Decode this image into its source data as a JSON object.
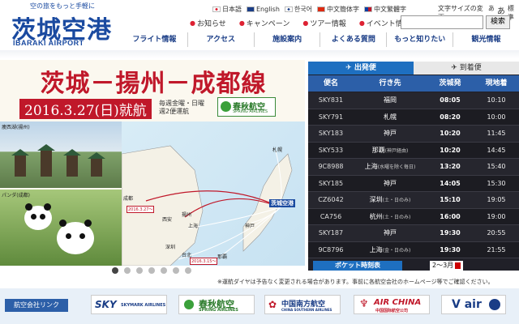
{
  "header": {
    "tagline": "空の旅をもっと手軽に",
    "logo_main": "茨城空港",
    "logo_sub": "IBARAKI AIRPORT",
    "languages": [
      {
        "label": "日本語",
        "flag_color": "#ffffff"
      },
      {
        "label": "English",
        "flag_color": "#1a3d86"
      },
      {
        "label": "한국어",
        "flag_color": "#ffffff"
      },
      {
        "label": "中文簡体字",
        "flag_color": "#de2910"
      },
      {
        "label": "中文繁體字",
        "flag_color": "#0a3ea3"
      }
    ],
    "font_size_label": "文字サイズの変更:",
    "font_sizes": [
      "あ",
      "あ",
      "標準"
    ],
    "sub_links": [
      "お知らせ",
      "キャンペーン",
      "ツアー情報",
      "イベント情報"
    ],
    "search_placeholder": "",
    "search_button": "検索"
  },
  "nav": {
    "items": [
      "フライト情報",
      "アクセス",
      "施設案内",
      "よくある質問",
      "もっと知りたい",
      "観光情報"
    ]
  },
  "banner": {
    "title": "茨城－揚州－成都線",
    "date": "2016.3.27(日)就航",
    "frequency": [
      "毎週金曜・日曜",
      "週2便運航"
    ],
    "spring_cn": "春秋航空",
    "spring_en": "SPRING AIRLINES",
    "photo1_label": "痩西湖(揚州)",
    "photo2_label": "パンダ(成都)",
    "map_cities": [
      "札幌",
      "茨城空港",
      "成都",
      "揚州",
      "上海",
      "神戸",
      "西安",
      "深圳",
      "台北",
      "那覇"
    ],
    "route_date_1": "2016.3.27～",
    "route_date_2": "2016.3.15～"
  },
  "slider": {
    "count": 7,
    "active": 0
  },
  "board": {
    "tab_departure": "出発便",
    "tab_arrival": "到着便",
    "headers": [
      "便名",
      "行き先",
      "茨城発",
      "現地着"
    ],
    "flights": [
      {
        "flight": "SKY831",
        "dest": "福岡",
        "note": "",
        "dep": "08:05",
        "arr": "10:10"
      },
      {
        "flight": "SKY791",
        "dest": "札幌",
        "note": "",
        "dep": "08:20",
        "arr": "10:00"
      },
      {
        "flight": "SKY183",
        "dest": "神戸",
        "note": "",
        "dep": "10:20",
        "arr": "11:45"
      },
      {
        "flight": "SKY533",
        "dest": "那覇",
        "note": "(神戸経由)",
        "dep": "10:20",
        "arr": "14:45"
      },
      {
        "flight": "9C8988",
        "dest": "上海",
        "note": "(水曜を除く毎日)",
        "dep": "13:20",
        "arr": "15:40"
      },
      {
        "flight": "SKY185",
        "dest": "神戸",
        "note": "",
        "dep": "14:05",
        "arr": "15:30"
      },
      {
        "flight": "CZ6042",
        "dest": "深圳",
        "note": "(土・日のみ)",
        "dep": "15:10",
        "arr": "19:05"
      },
      {
        "flight": "CA756",
        "dest": "杭州",
        "note": "(土・日のみ)",
        "dep": "16:00",
        "arr": "19:00"
      },
      {
        "flight": "SKY187",
        "dest": "神戸",
        "note": "",
        "dep": "19:30",
        "arr": "20:55"
      },
      {
        "flight": "9C8796",
        "dest": "上海",
        "note": "(金・日のみ)",
        "dep": "19:30",
        "arr": "21:55"
      }
    ],
    "pocket_label": "ポケット時刻表",
    "pocket_month": "2～3月"
  },
  "notice": "※運航ダイヤは予告なく変更される場合があります。事前に各航空会社のホームページ等でご確認ください。",
  "airlines": {
    "label": "航空会社リンク",
    "items": [
      {
        "name": "SKY",
        "sub": "SKYMARK AIRLINES",
        "color": "#1a3d86"
      },
      {
        "name": "春秋航空",
        "sub": "SPRING AIRLINES",
        "color": "#2a7a2a"
      },
      {
        "name": "中国南方航空",
        "sub": "CHINA SOUTHERN AIRLINES",
        "color": "#1a3d86"
      },
      {
        "name": "AIR CHINA",
        "sub": "中国国际航空公司",
        "color": "#c0182a"
      },
      {
        "name": "V air",
        "sub": "",
        "color": "#1a3d86"
      }
    ]
  }
}
